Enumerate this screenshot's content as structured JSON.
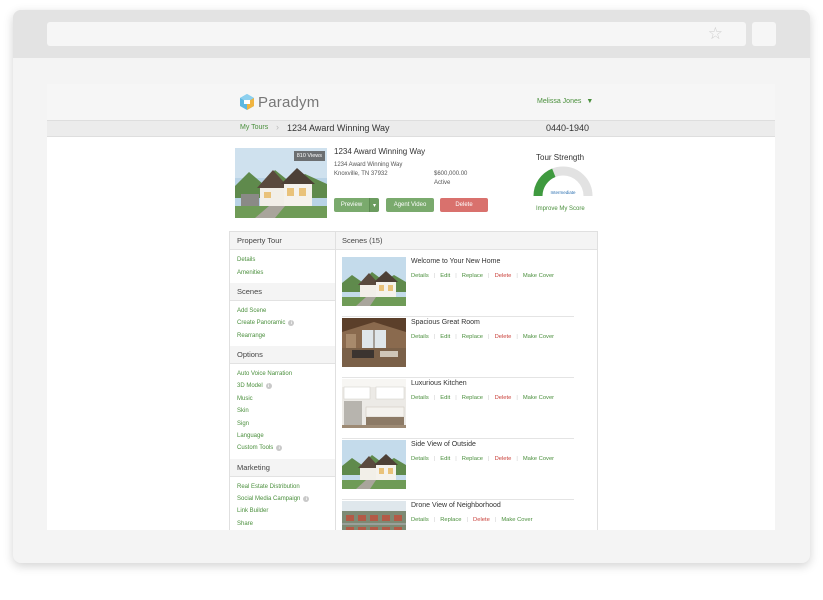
{
  "brand": {
    "name": "Paradym",
    "accent": "#4a8f3c",
    "delete_color": "#d9716d"
  },
  "header": {
    "user": "Melissa Jones",
    "user_caret": "▼"
  },
  "breadcrumb": {
    "link": "My Tours",
    "title": "1234 Award Winning Way",
    "id": "0440-1940"
  },
  "property": {
    "title": "1234 Award Winning Way",
    "address1": "1234 Award Winning Way",
    "address2": "Knoxville, TN 37932",
    "price": "$600,000.00",
    "status": "Active",
    "views": "810 Views",
    "buttons": {
      "preview": "Preview",
      "dropdown": "▾",
      "agent_video": "Agent Video",
      "delete": "Delete"
    }
  },
  "tour_strength": {
    "title": "Tour Strength",
    "level": "Intermediate",
    "fill_fraction": 0.38,
    "improve_link": "Improve My Score"
  },
  "sidebar": {
    "sections": [
      {
        "title": "Property Tour",
        "items": [
          {
            "label": "Details",
            "info": false
          },
          {
            "label": "Amenities",
            "info": false
          }
        ]
      },
      {
        "title": "Scenes",
        "items": [
          {
            "label": "Add Scene",
            "info": false
          },
          {
            "label": "Create Panoramic",
            "info": true
          },
          {
            "label": "Rearrange",
            "info": false
          }
        ]
      },
      {
        "title": "Options",
        "items": [
          {
            "label": "Auto Voice Narration",
            "info": false
          },
          {
            "label": "3D Model",
            "info": true
          },
          {
            "label": "Music",
            "info": false
          },
          {
            "label": "Skin",
            "info": false
          },
          {
            "label": "Sign",
            "info": false
          },
          {
            "label": "Language",
            "info": false
          },
          {
            "label": "Custom Tools",
            "info": true
          }
        ]
      },
      {
        "title": "Marketing",
        "items": [
          {
            "label": "Real Estate Distribution",
            "info": false
          },
          {
            "label": "Social Media Campaign",
            "info": true
          },
          {
            "label": "Link Builder",
            "info": false
          },
          {
            "label": "Share",
            "info": false
          }
        ]
      }
    ]
  },
  "scenes": {
    "title": "Scenes (15)",
    "items": [
      {
        "title": "Welcome to Your New Home",
        "image": "house-exterior",
        "actions": [
          "Details",
          "Edit",
          "Replace",
          "Delete",
          "Make Cover"
        ]
      },
      {
        "title": "Spacious Great Room",
        "image": "great-room",
        "actions": [
          "Details",
          "Edit",
          "Replace",
          "Delete",
          "Make Cover"
        ]
      },
      {
        "title": "Luxurious Kitchen",
        "image": "kitchen",
        "actions": [
          "Details",
          "Edit",
          "Replace",
          "Delete",
          "Make Cover"
        ]
      },
      {
        "title": "Side View of Outside",
        "image": "house-exterior",
        "actions": [
          "Details",
          "Edit",
          "Replace",
          "Delete",
          "Make Cover"
        ]
      },
      {
        "title": "Drone View of Neighborhood",
        "image": "neighborhood-aerial",
        "actions": [
          "Details",
          "Replace",
          "Delete",
          "Make Cover"
        ]
      }
    ]
  }
}
